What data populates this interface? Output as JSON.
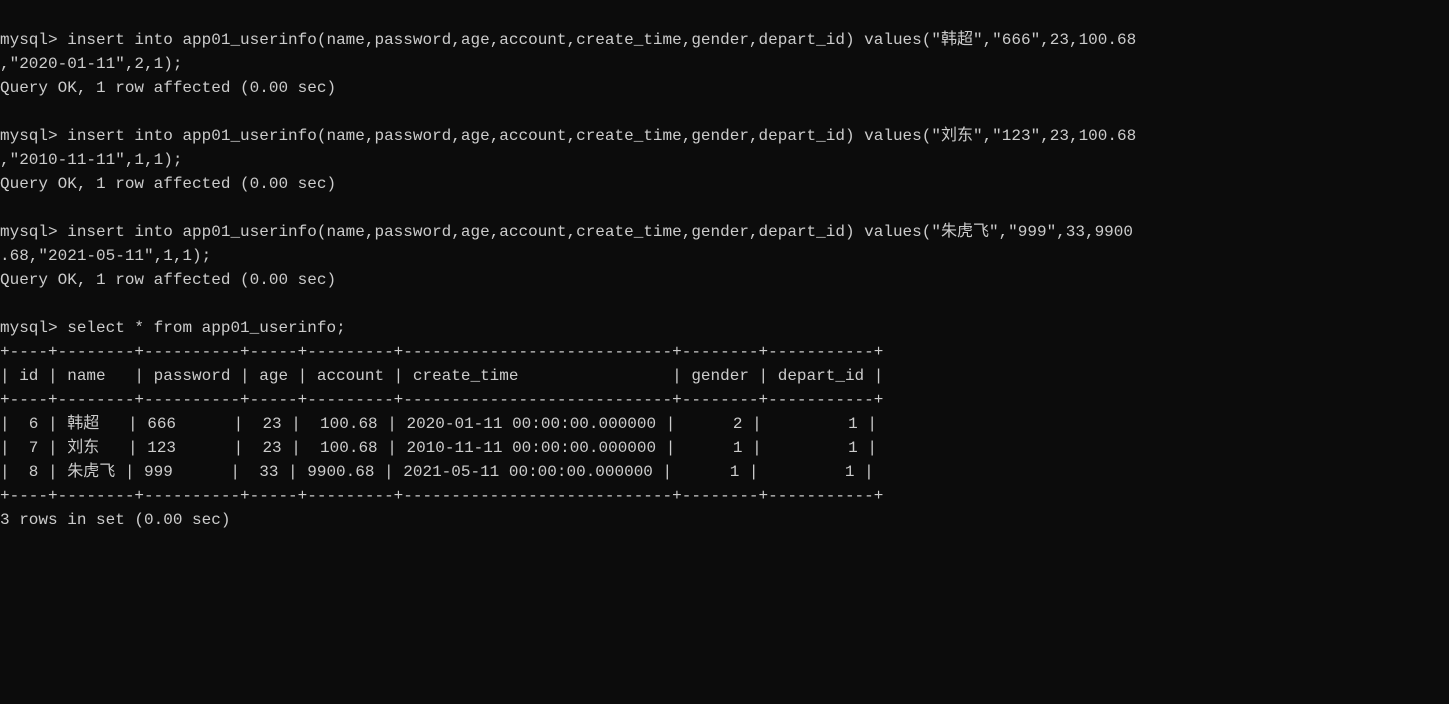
{
  "statements": [
    {
      "prompt": "mysql>",
      "line1": "insert into app01_userinfo(name,password,age,account,create_time,gender,depart_id) values(\"韩超\",\"666\",23,100.68",
      "line2": ",\"2020-01-11\",2,1);",
      "result": "Query OK, 1 row affected (0.00 sec)"
    },
    {
      "prompt": "mysql>",
      "line1": "insert into app01_userinfo(name,password,age,account,create_time,gender,depart_id) values(\"刘东\",\"123\",23,100.68",
      "line2": ",\"2010-11-11\",1,1);",
      "result": "Query OK, 1 row affected (0.00 sec)"
    },
    {
      "prompt": "mysql>",
      "line1": "insert into app01_userinfo(name,password,age,account,create_time,gender,depart_id) values(\"朱虎飞\",\"999\",33,9900",
      "line2": ".68,\"2021-05-11\",1,1);",
      "result": "Query OK, 1 row affected (0.00 sec)"
    }
  ],
  "select": {
    "prompt": "mysql>",
    "query": "select * from app01_userinfo;",
    "result": "3 rows in set (0.00 sec)"
  },
  "table": {
    "border": "+----+--------+----------+-----+---------+----------------------------+--------+-----------+",
    "header": "| id | name   | password | age | account | create_time                | gender | depart_id |",
    "rows": [
      "|  6 | 韩超   | 666      |  23 |  100.68 | 2020-01-11 00:00:00.000000 |      2 |         1 |",
      "|  7 | 刘东   | 123      |  23 |  100.68 | 2010-11-11 00:00:00.000000 |      1 |         1 |",
      "|  8 | 朱虎飞 | 999      |  33 | 9900.68 | 2021-05-11 00:00:00.000000 |      1 |         1 |"
    ]
  }
}
